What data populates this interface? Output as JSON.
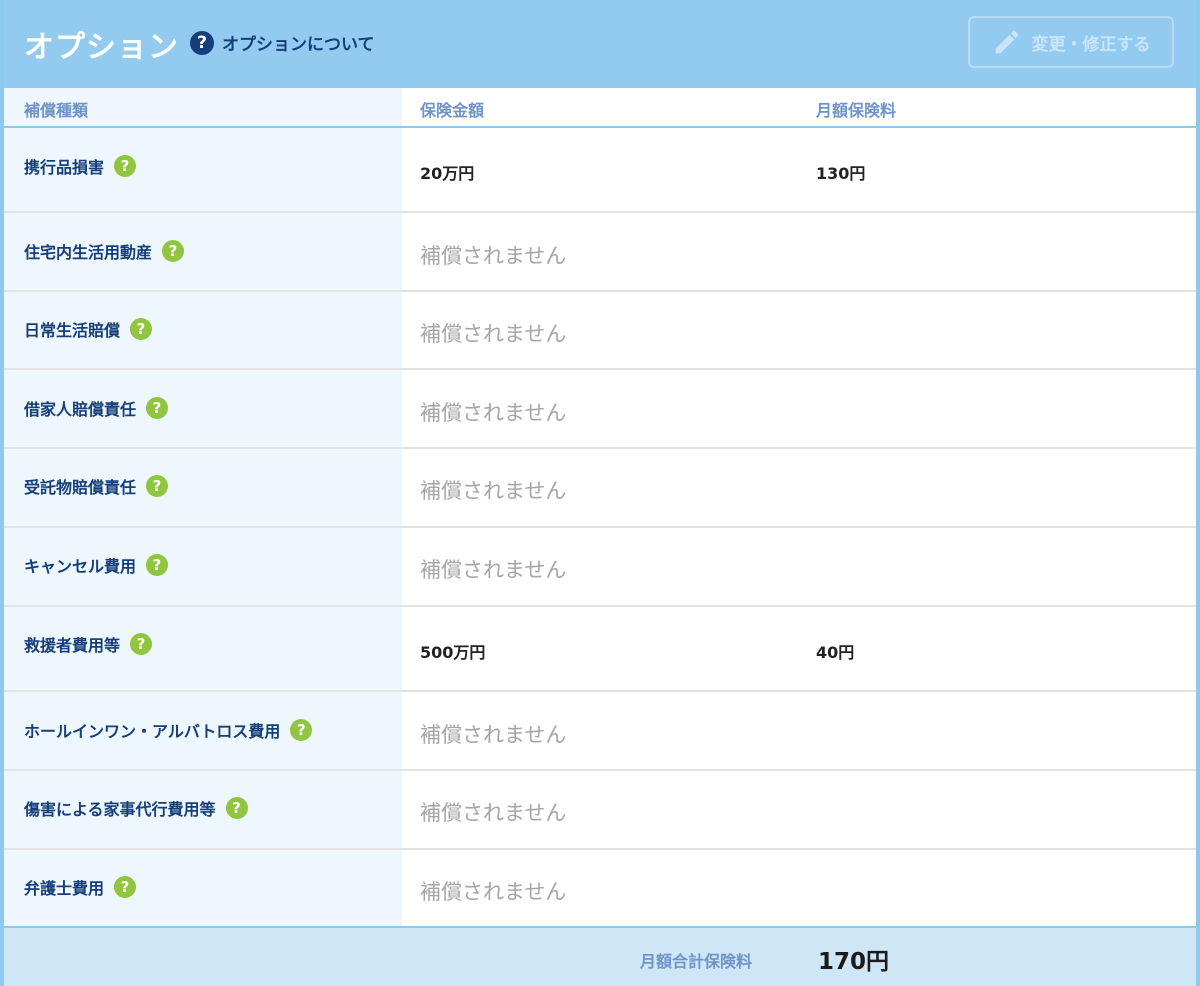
{
  "header": {
    "title": "オプション",
    "help_link": "オプションについて",
    "edit_button": "変更・修正する"
  },
  "columns": {
    "type": "補償種類",
    "amount": "保険金額",
    "premium": "月額保険料"
  },
  "rows": [
    {
      "name": "携行品損害",
      "amount": "20万円",
      "premium": "130円",
      "not_covered": ""
    },
    {
      "name": "住宅内生活用動産",
      "amount": "",
      "premium": "",
      "not_covered": "補償されません"
    },
    {
      "name": "日常生活賠償",
      "amount": "",
      "premium": "",
      "not_covered": "補償されません"
    },
    {
      "name": "借家人賠償責任",
      "amount": "",
      "premium": "",
      "not_covered": "補償されません"
    },
    {
      "name": "受託物賠償責任",
      "amount": "",
      "premium": "",
      "not_covered": "補償されません"
    },
    {
      "name": "キャンセル費用",
      "amount": "",
      "premium": "",
      "not_covered": "補償されません"
    },
    {
      "name": "救援者費用等",
      "amount": "500万円",
      "premium": "40円",
      "not_covered": ""
    },
    {
      "name": "ホールインワン・アルバトロス費用",
      "amount": "",
      "premium": "",
      "not_covered": "補償されません"
    },
    {
      "name": "傷害による家事代行費用等",
      "amount": "",
      "premium": "",
      "not_covered": "補償されません"
    },
    {
      "name": "弁護士費用",
      "amount": "",
      "premium": "",
      "not_covered": "補償されません"
    }
  ],
  "footer": {
    "label": "月額合計保険料",
    "total": "170円"
  },
  "icons": {
    "help": "question-circle-icon",
    "row_help": "question-circle-icon",
    "edit": "pencil-icon"
  },
  "colors": {
    "header_bg": "#93cbf0",
    "navy": "#163e7a",
    "help_green": "#8fc53f",
    "muted": "#a5a5a5",
    "footer_bg": "#cfe6f7"
  }
}
